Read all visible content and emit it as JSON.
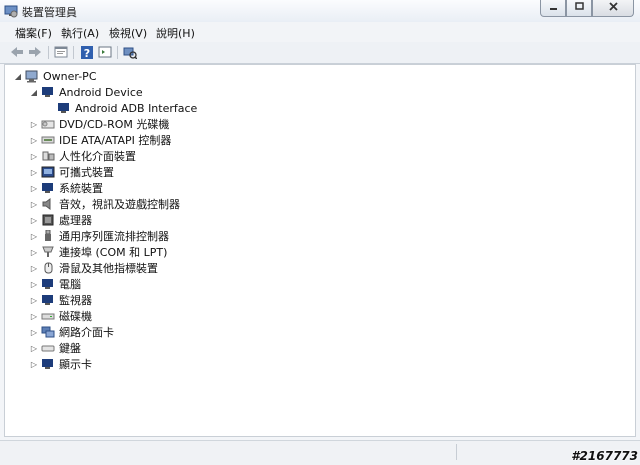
{
  "window": {
    "title": "裝置管理員",
    "minimize_icon": "minimize-icon",
    "maximize_icon": "maximize-icon",
    "close_icon": "close-icon"
  },
  "menu": [
    "檔案(F)",
    "執行(A)",
    "檢視(V)",
    "說明(H)"
  ],
  "toolbar": [
    "back-icon",
    "forward-icon",
    "properties-icon",
    "help-icon",
    "console-icon",
    "scan-hardware-icon"
  ],
  "tree": {
    "root": "Owner-PC",
    "android": {
      "label": "Android Device",
      "child": "Android ADB Interface"
    },
    "categories": [
      "DVD/CD-ROM 光碟機",
      "IDE ATA/ATAPI 控制器",
      "人性化介面裝置",
      "可攜式裝置",
      "系統裝置",
      "音效，視訊及遊戲控制器",
      "處理器",
      "通用序列匯流排控制器",
      "連接埠 (COM 和 LPT)",
      "滑鼠及其他指標裝置",
      "電腦",
      "監視器",
      "磁碟機",
      "網路介面卡",
      "鍵盤",
      "顯示卡"
    ]
  },
  "watermark": "#2167773"
}
